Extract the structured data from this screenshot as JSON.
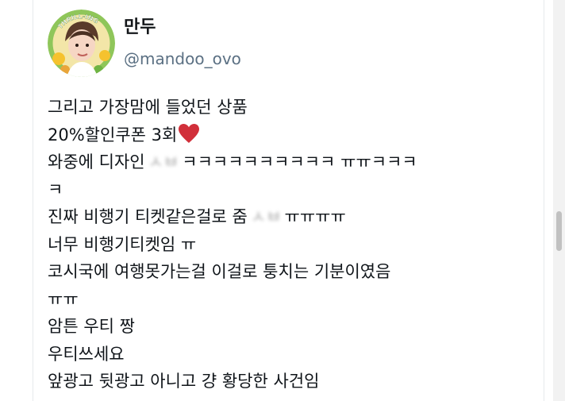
{
  "tweet": {
    "display_name": "만두",
    "handle": "@mandoo_ovo",
    "avatar_badge": "THRILL-ING",
    "lines": {
      "l1": "그리고 가장맘에 들었던 상품",
      "l2": "20%할인쿠폰 3회",
      "l3a": "와중에 디자인",
      "l3blur": "ㅅㅂ",
      "l3b": "ㅋㅋㅋㅋㅋㅋㅋㅋㅋㅋ ㅠㅠㅋㅋㅋ",
      "l4": "ㅋ",
      "l5a": "진짜 비행기 티켓같은걸로 줌",
      "l5blur": "ㅅㅂ",
      "l5b": "ㅠㅠㅠㅠ",
      "l6": "너무 비행기티켓임 ㅠ",
      "l7": "코시국에 여행못가는걸 이걸로 퉁치는 기분이였음",
      "l8": "ㅠㅠ",
      "l9": "암튼 우티 짱",
      "l10": "우티쓰세요",
      "l11": "앞광고 뒷광고 아니고 걍 황당한 사건임"
    },
    "heart_color": "#d12f3a"
  }
}
